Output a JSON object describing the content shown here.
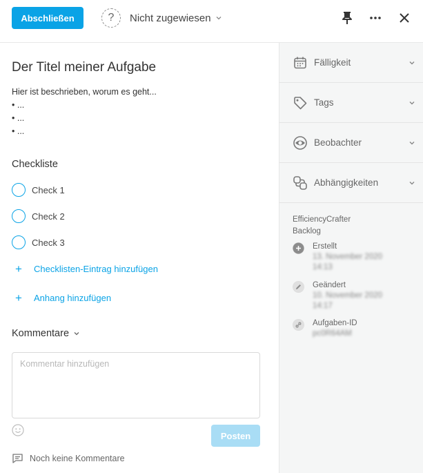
{
  "header": {
    "complete_label": "Abschließen",
    "assignee_label": "Nicht zugewiesen",
    "icons": [
      "question-icon",
      "pin-icon",
      "more-icon",
      "close-icon"
    ]
  },
  "task": {
    "title": "Der Titel meiner Aufgabe",
    "description": {
      "intro": "Hier ist beschrieben, worum es geht...",
      "bullets": [
        "• ...",
        "• ...",
        "• ..."
      ]
    }
  },
  "checklist": {
    "heading": "Checkliste",
    "items": [
      {
        "label": "Check 1",
        "checked": false
      },
      {
        "label": "Check 2",
        "checked": false
      },
      {
        "label": "Check 3",
        "checked": false
      }
    ],
    "add_entry_label": "Checklisten-Eintrag hinzufügen",
    "add_attachment_label": "Anhang hinzufügen"
  },
  "comments": {
    "heading": "Kommentare",
    "placeholder": "Kommentar hinzufügen",
    "post_label": "Posten",
    "empty_label": "Noch keine Kommentare"
  },
  "sidebar": {
    "items": [
      {
        "label": "Fälligkeit",
        "icon": "calendar-icon"
      },
      {
        "label": "Tags",
        "icon": "tag-icon"
      },
      {
        "label": "Beobachter",
        "icon": "eye-icon"
      },
      {
        "label": "Abhängigkeiten",
        "icon": "dependencies-icon"
      }
    ],
    "project": "EfficiencyCrafter",
    "board": "Backlog",
    "meta": [
      {
        "label": "Erstellt",
        "value_line1": "13. November 2020",
        "value_line2": "14:13",
        "icon": "plus-circle-icon"
      },
      {
        "label": "Geändert",
        "value_line1": "10. November 2020",
        "value_line2": "14:17",
        "icon": "pencil-icon"
      },
      {
        "label": "Aufgaben-ID",
        "value_line1": "pc0R64AM",
        "icon": "link-icon"
      }
    ]
  },
  "colors": {
    "accent": "#0aa3e6",
    "accent_disabled": "#a9ddf5",
    "sidebar_bg": "#f5f6f6"
  }
}
